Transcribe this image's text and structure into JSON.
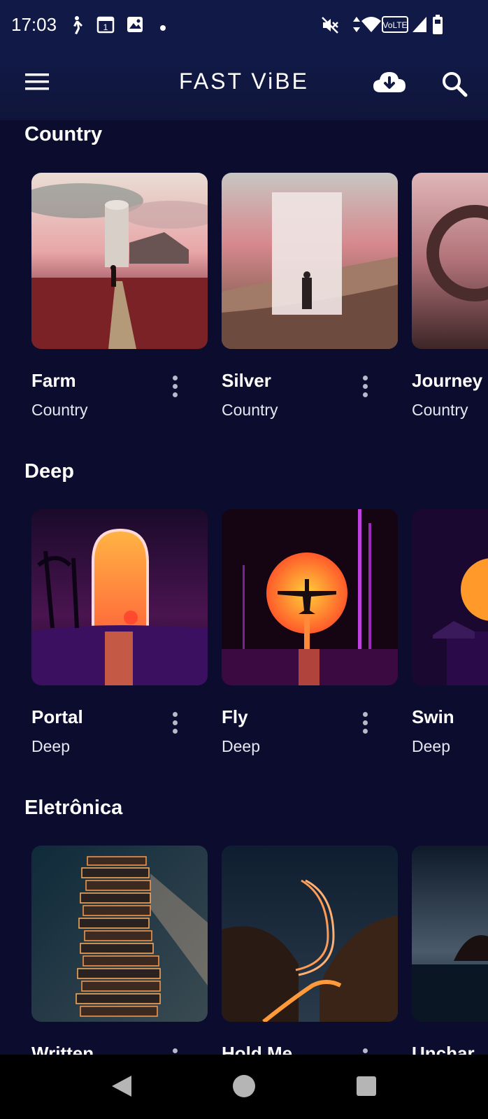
{
  "status_bar": {
    "time": "17:03",
    "left_icons": [
      "walk-icon",
      "calendar-icon",
      "photo-icon",
      "dot-icon"
    ],
    "right_icons": [
      "mute-icon",
      "data-arrows-icon",
      "wifi-icon",
      "volte-icon",
      "signal-icon",
      "battery-icon"
    ],
    "volte_label": "VoLTE",
    "calendar_day": "1"
  },
  "app_bar": {
    "title": "FAST ViBE",
    "menu_icon": "menu-icon",
    "download_icon": "cloud-download-icon",
    "search_icon": "search-icon"
  },
  "sections": [
    {
      "title": "Country",
      "items": [
        {
          "title": "Farm",
          "genre": "Country"
        },
        {
          "title": "Silver",
          "genre": "Country"
        },
        {
          "title": "Journey",
          "genre": "Country"
        }
      ]
    },
    {
      "title": "Deep",
      "items": [
        {
          "title": "Portal",
          "genre": "Deep"
        },
        {
          "title": "Fly",
          "genre": "Deep"
        },
        {
          "title": "Swin",
          "genre": "Deep"
        }
      ]
    },
    {
      "title": "Eletrônica",
      "items": [
        {
          "title": "Written",
          "genre": ""
        },
        {
          "title": "Hold Me",
          "genre": ""
        },
        {
          "title": "Unchar",
          "genre": ""
        }
      ]
    }
  ],
  "nav_bar": {
    "icons": [
      "back-icon",
      "home-icon",
      "recents-icon"
    ]
  },
  "colors": {
    "background": "#0c0c2e",
    "app_bar": "#111a47",
    "text": "#ffffff"
  }
}
